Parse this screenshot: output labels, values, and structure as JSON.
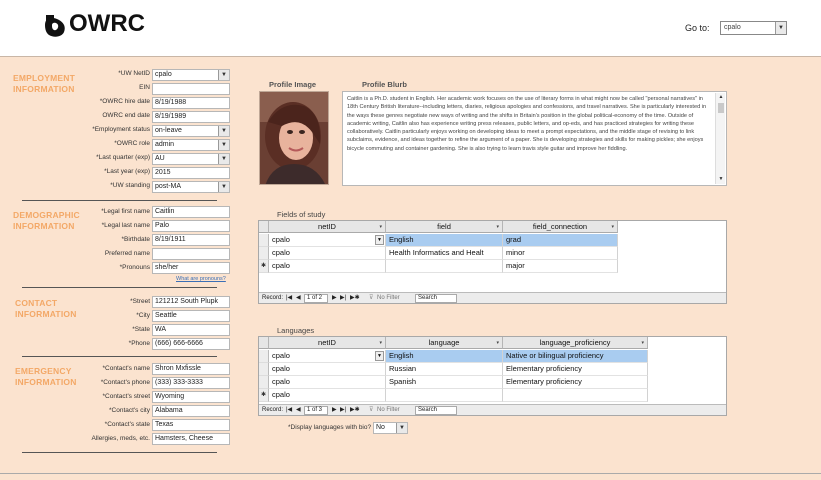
{
  "header": {
    "logo_text": "OWRC",
    "goto_label": "Go to:",
    "goto_value": "cpalo"
  },
  "employment": {
    "title_line1": "EMPLOYMENT",
    "title_line2": "INFORMATION",
    "fields": [
      {
        "label": "*UW NetID",
        "value": "cpalo",
        "combo": true
      },
      {
        "label": "EIN",
        "value": "",
        "combo": false
      },
      {
        "label": "*OWRC hire date",
        "value": "8/19/1988",
        "combo": false
      },
      {
        "label": "OWRC end date",
        "value": "8/19/1989",
        "combo": false
      },
      {
        "label": "*Employment status",
        "value": "on-leave",
        "combo": true
      },
      {
        "label": "*OWRC role",
        "value": "admin",
        "combo": true
      },
      {
        "label": "*Last quarter (exp)",
        "value": "AU",
        "combo": true
      },
      {
        "label": "*Last year (exp)",
        "value": "2015",
        "combo": false
      },
      {
        "label": "*UW standing",
        "value": "post-MA",
        "combo": true
      }
    ]
  },
  "demographic": {
    "title_line1": "DEMOGRAPHIC",
    "title_line2": "INFORMATION",
    "fields": [
      {
        "label": "*Legal first name",
        "value": "Caitlin"
      },
      {
        "label": "*Legal last name",
        "value": "Palo"
      },
      {
        "label": "*Birthdate",
        "value": "8/19/1911"
      },
      {
        "label": "Preferred name",
        "value": ""
      },
      {
        "label": "*Pronouns",
        "value": "she/her"
      }
    ],
    "pronouns_link": "What are pronouns?"
  },
  "contact": {
    "title_line1": "CONTACT",
    "title_line2": "INFORMATION",
    "fields": [
      {
        "label": "*Street",
        "value": "121212 South Plupk"
      },
      {
        "label": "*City",
        "value": "Seattle"
      },
      {
        "label": "*State",
        "value": "WA"
      },
      {
        "label": "*Phone",
        "value": "(666) 666-6666"
      }
    ]
  },
  "emergency": {
    "title_line1": "EMERGENCY",
    "title_line2": "INFORMATION",
    "fields": [
      {
        "label": "*Contact's name",
        "value": "Shron Mxfissle"
      },
      {
        "label": "*Contact's phone",
        "value": "(333) 333-3333"
      },
      {
        "label": "*Contact's street",
        "value": "Wyoming"
      },
      {
        "label": "*Contact's city",
        "value": "Alabama"
      },
      {
        "label": "*Contact's state",
        "value": "Texas"
      },
      {
        "label": "Allergies, meds, etc.",
        "value": "Hamsters, Cheese"
      }
    ]
  },
  "profile": {
    "image_caption": "Profile Image",
    "blurb_caption": "Profile Blurb",
    "blurb_text": "Caitlin is a Ph.D. student in English. Her academic work focuses on the use of literary forms in what might now be called \"personal narratives\" in 18th Century British literature--including letters, diaries, religious apologies and confessions, and travel narratives. She is particularly interested in the ways these genres negotiate new ways of writing and the shifts in Britain's position in the global political-economy of the time. Outside of academic writing, Caitlin also has experience writing press releases, public letters, and op-eds, and has practiced strategies for writing these collaboratively. Caitlin particularly enjoys working on developing ideas to meet a prompt expectations, and the middle stage of revising to link subclaims, evidence, and ideas together to refine the argument of a paper. She is developing strategies and skills for making pickles; she enjoys bicycle commuting and container gardening. She is also trying to learn travis style guitar and improve her fiddling."
  },
  "fields_of_study": {
    "caption": "Fields of study",
    "columns": [
      "netID",
      "field",
      "field_connection"
    ],
    "rows": [
      {
        "netID": "cpalo",
        "field": "English",
        "field_connection": "grad",
        "selected": true
      },
      {
        "netID": "cpalo",
        "field": "Health Informatics and Healt",
        "field_connection": "minor",
        "selected": false
      },
      {
        "netID": "cpalo",
        "field": "",
        "field_connection": "major",
        "selected": false
      }
    ],
    "nav": {
      "record_label": "Record:",
      "position": "1 of 2",
      "filter": "No Filter",
      "search": "Search"
    }
  },
  "languages": {
    "caption": "Languages",
    "columns": [
      "netID",
      "language",
      "language_proficiency"
    ],
    "rows": [
      {
        "netID": "cpalo",
        "language": "English",
        "language_proficiency": "Native or bilingual proficiency",
        "selected": true
      },
      {
        "netID": "cpalo",
        "language": "Russian",
        "language_proficiency": "Elementary proficiency",
        "selected": false
      },
      {
        "netID": "cpalo",
        "language": "Spanish",
        "language_proficiency": "Elementary proficiency",
        "selected": false
      },
      {
        "netID": "cpalo",
        "language": "",
        "language_proficiency": "",
        "selected": false
      }
    ],
    "nav": {
      "record_label": "Record:",
      "position": "1 of 3",
      "filter": "No Filter",
      "search": "Search"
    },
    "display_label": "*Display languages with bio?",
    "display_value": "No"
  },
  "colors": {
    "background": "#fbe3cf",
    "section_title": "#f3a867",
    "selection": "#a9ccf0"
  }
}
